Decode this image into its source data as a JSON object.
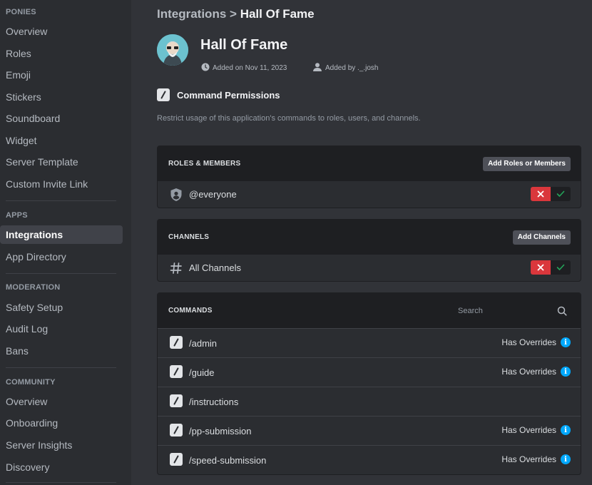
{
  "sidebar": {
    "sections": [
      {
        "heading": "PONIES",
        "items": [
          "Overview",
          "Roles",
          "Emoji",
          "Stickers",
          "Soundboard",
          "Widget",
          "Server Template",
          "Custom Invite Link"
        ]
      },
      {
        "heading": "APPS",
        "items": [
          "Integrations",
          "App Directory"
        ]
      },
      {
        "heading": "MODERATION",
        "items": [
          "Safety Setup",
          "Audit Log",
          "Bans"
        ]
      },
      {
        "heading": "COMMUNITY",
        "items": [
          "Overview",
          "Onboarding",
          "Server Insights",
          "Discovery"
        ]
      }
    ],
    "active_item": "Integrations"
  },
  "breadcrumb": {
    "parent": "Integrations",
    "separator": ">",
    "current": "Hall Of Fame"
  },
  "app": {
    "name": "Hall Of Fame",
    "added_on": "Added on Nov 11, 2023",
    "added_by": "Added by ._.josh"
  },
  "command_permissions": {
    "title": "Command Permissions",
    "description": "Restrict usage of this application's commands to roles, users, and channels."
  },
  "roles_panel": {
    "label": "ROLES & MEMBERS",
    "button": "Add Roles or Members",
    "rows": [
      {
        "name": "@everyone",
        "state": "deny"
      }
    ]
  },
  "channels_panel": {
    "label": "CHANNELS",
    "button": "Add Channels",
    "rows": [
      {
        "name": "All Channels",
        "state": "deny"
      }
    ]
  },
  "commands_panel": {
    "label": "COMMANDS",
    "search_placeholder": "Search",
    "rows": [
      {
        "name": "/admin",
        "status": "Has Overrides"
      },
      {
        "name": "/guide",
        "status": "Has Overrides"
      },
      {
        "name": "/instructions",
        "status": ""
      },
      {
        "name": "/pp-submission",
        "status": "Has Overrides"
      },
      {
        "name": "/speed-submission",
        "status": "Has Overrides"
      }
    ]
  },
  "colors": {
    "deny": "#da373c",
    "allow_check": "#23a55a",
    "info": "#00a8fc",
    "active_bg": "#404249"
  }
}
